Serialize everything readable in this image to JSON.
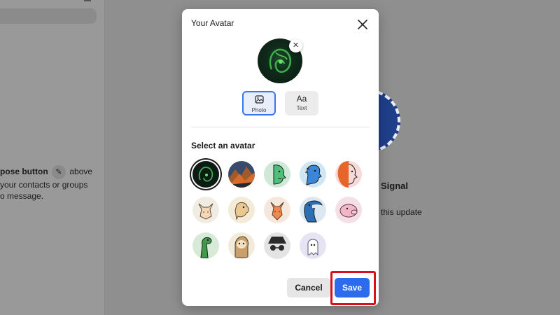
{
  "background": {
    "hint_bold": "pose button",
    "hint_after_icon": "above",
    "hint_line2": "your contacts or groups",
    "hint_line3": "o message.",
    "title": "Signal",
    "subtitle": "this update",
    "pencil_icon": "pencil-icon"
  },
  "modal": {
    "title": "Your Avatar",
    "close_icon": "close-icon",
    "clear_icon": "x-icon",
    "type_buttons": [
      {
        "glyph": "🖼",
        "label": "Photo",
        "icon": "photo-icon",
        "selected": true
      },
      {
        "glyph": "Aa",
        "label": "Text",
        "icon": "text-icon",
        "selected": false
      }
    ],
    "section_title": "Select an avatar",
    "avatars": [
      {
        "name": "uploaded-photo",
        "bg": "#0c1c14",
        "selected": true
      },
      {
        "name": "mountain-photo",
        "bg": "#6a4030"
      },
      {
        "name": "face-green",
        "bg": "#cfe9d7"
      },
      {
        "name": "face-blue",
        "bg": "#cfe6f4"
      },
      {
        "name": "face-orange",
        "bg": "#f7d9d9"
      },
      {
        "name": "cat",
        "bg": "#f1ece2"
      },
      {
        "name": "dog",
        "bg": "#f3ead7"
      },
      {
        "name": "fox",
        "bg": "#f6e7dd"
      },
      {
        "name": "tucan",
        "bg": "#dbe8f2"
      },
      {
        "name": "pig",
        "bg": "#f4dfe6"
      },
      {
        "name": "dinosaur",
        "bg": "#d7ead8"
      },
      {
        "name": "sloth",
        "bg": "#f1ebd9"
      },
      {
        "name": "incognito",
        "bg": "#e3e3e3"
      },
      {
        "name": "ghost",
        "bg": "#e6e4f3"
      }
    ],
    "cancel_label": "Cancel",
    "save_label": "Save"
  },
  "colors": {
    "accent": "#2c6bed",
    "highlight": "#d8101c"
  }
}
